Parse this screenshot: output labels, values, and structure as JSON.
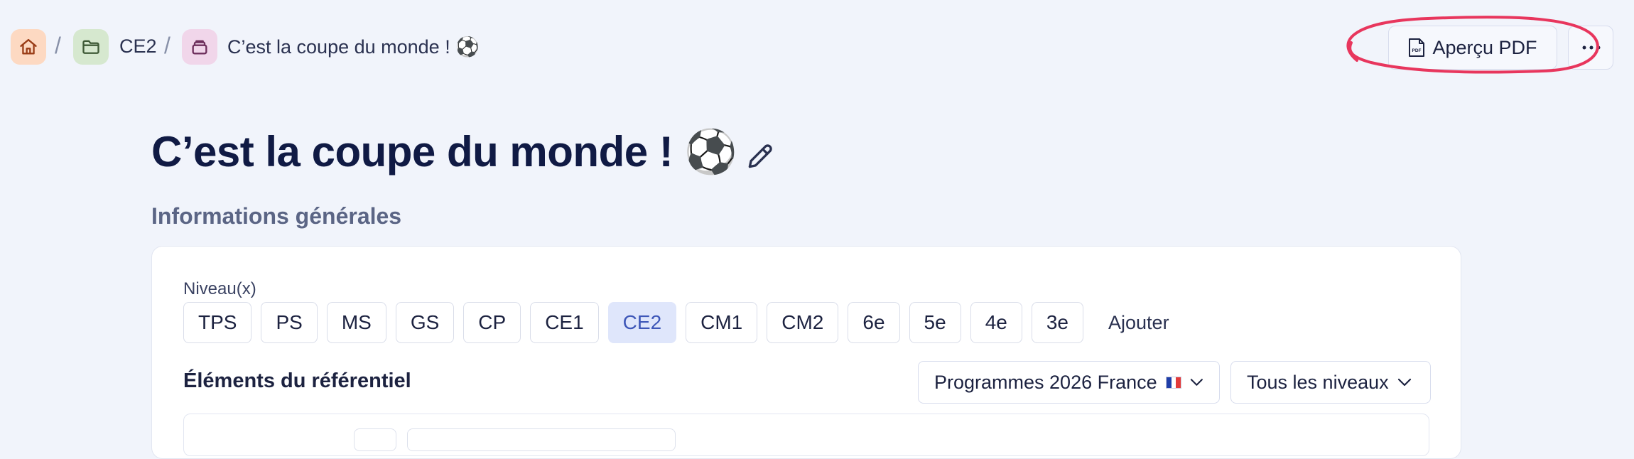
{
  "breadcrumb": {
    "items": [
      {
        "label": "",
        "icon": "home-icon",
        "bg": "#fdd9c2",
        "color": "#9a3d17"
      },
      {
        "label": "CE2",
        "icon": "folder-icon",
        "bg": "#d6e8cf",
        "color": "#3f5a37"
      },
      {
        "label": "C’est la coupe du monde ! ⚽",
        "icon": "stack-icon",
        "bg": "#f1d6ea",
        "color": "#6e2f5c"
      }
    ],
    "separator": "/"
  },
  "toolbar": {
    "pdf_label": "Aperçu PDF",
    "pdf_icon_text": "PDF",
    "more_icon": "more-icon"
  },
  "annotation_color": "#e8365d",
  "page": {
    "title": "C’est la coupe du monde ! ⚽",
    "section_title": "Informations générales"
  },
  "niveaux": {
    "label": "Niveau(x)",
    "options": [
      "TPS",
      "PS",
      "MS",
      "GS",
      "CP",
      "CE1",
      "CE2",
      "CM1",
      "CM2",
      "6e",
      "5e",
      "4e",
      "3e"
    ],
    "selected": "CE2",
    "add_label": "Ajouter"
  },
  "referentiel": {
    "title": "Éléments du référentiel",
    "program_select": "Programmes 2026 France",
    "level_select": "Tous les niveaux"
  },
  "colors": {
    "accent_selected_bg": "#dfe6fb",
    "accent_selected_text": "#3e57b8",
    "title": "#101a44"
  }
}
